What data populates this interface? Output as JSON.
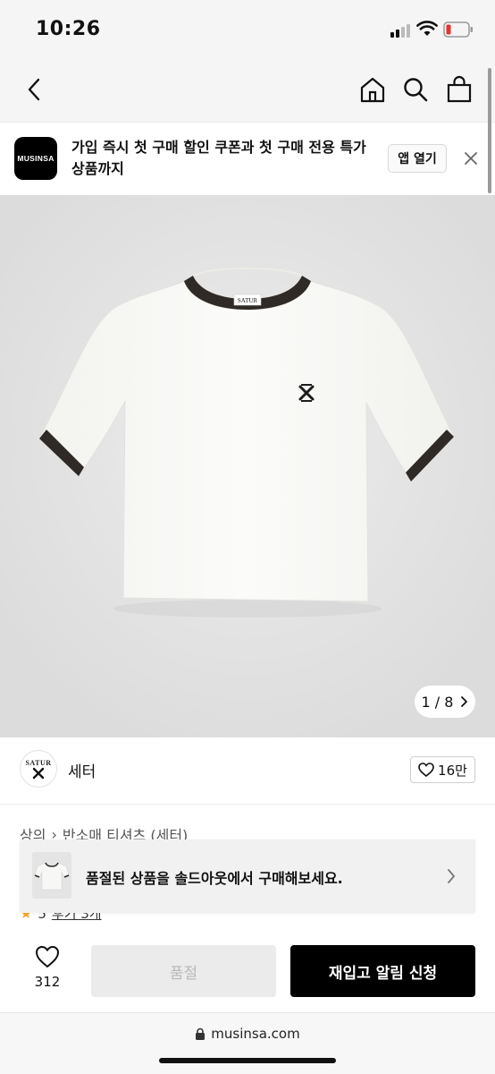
{
  "status_bar": {
    "time": "10:26"
  },
  "app_banner": {
    "logo_text": "MUSINSA",
    "message": "가입 즉시 첫 구매 할인 쿠폰과 첫 구매 전용 특가 상품까지",
    "open_button": "앱 열기"
  },
  "gallery": {
    "current": "1",
    "separator": "/",
    "total": "8"
  },
  "shirt_label": "SATUR",
  "brand": {
    "logo_text": "SATUR",
    "name": "세터",
    "likes": "16만"
  },
  "breadcrumb": {
    "category": "상의",
    "subcategory": "반소매 티셔츠 (세터)"
  },
  "rating": {
    "score": "5",
    "reviews": "후기 3개"
  },
  "soldout_toast": {
    "message": "품절된 상품을 솔드아웃에서 구매해보세요."
  },
  "bottom_bar": {
    "like_count": "312",
    "soldout_label": "품절",
    "restock_label": "재입고 알림 신청"
  },
  "browser": {
    "url": "musinsa.com"
  },
  "colors": {
    "accent": "#000000",
    "star": "#f5a623",
    "soldout_bg": "#ebebeb",
    "battery_low": "#e5322d"
  }
}
